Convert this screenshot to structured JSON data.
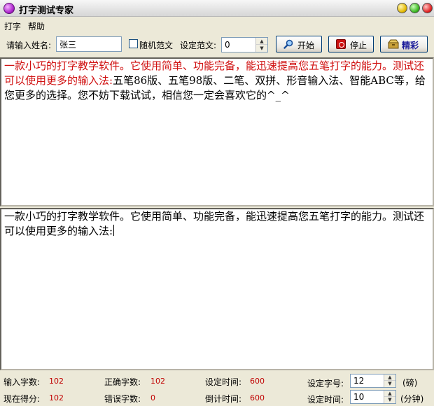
{
  "window": {
    "title": "打字测试专家"
  },
  "menu": [
    "打字",
    "帮助"
  ],
  "toolbar": {
    "name_label": "请输入姓名:",
    "name_value": "张三",
    "random_label": "随机范文",
    "random_checked": false,
    "sample_label": "设定范文:",
    "sample_value": "0",
    "start_label": "开始",
    "stop_label": "停止",
    "fine_label": "精彩"
  },
  "source_text": {
    "typed": "一款小巧的打字教学软件。它使用简单、功能完备，能迅速提高您五笔打字的能力。测试还可以使用更多的输入法:",
    "remaining": "五笔86版、五笔98版、二笔、双拼、形音输入法、智能ABC等，给您更多的选择。您不妨下载试试，相信您一定会喜欢它的^_^"
  },
  "typing_text": "一款小巧的打字教学软件。它使用简单、功能完备，能迅速提高您五笔打字的能力。测试还可以使用更多的输入法:",
  "stats": {
    "input_count_label": "输入字数:",
    "input_count": "102",
    "correct_label": "正确字数:",
    "correct": "102",
    "set_time_label": "设定时间:",
    "set_time": "600",
    "score_label": "现在得分:",
    "score": "102",
    "error_label": "错误字数:",
    "error": "0",
    "countdown_label": "倒计时间:",
    "countdown": "600",
    "font_size_label": "设定字号:",
    "font_size": "12",
    "font_size_unit": "(磅)",
    "time_setting_label": "设定时间:",
    "time_setting": "10",
    "time_setting_unit": "(分钟)"
  },
  "colors": {
    "typed_text": "#d01010",
    "stat_value": "#c00000"
  }
}
